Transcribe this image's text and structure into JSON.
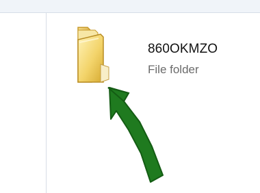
{
  "file_list": {
    "item": {
      "name": "860OKMZO",
      "type": "File folder",
      "icon": "folder-icon"
    }
  },
  "annotation": {
    "icon": "arrow-up-icon",
    "color": "#1f7a1f"
  }
}
